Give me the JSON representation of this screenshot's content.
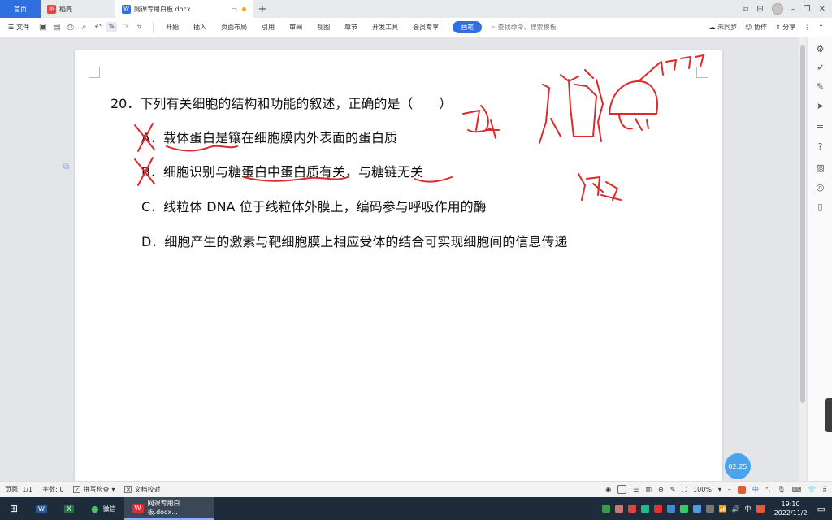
{
  "titlebar": {
    "home_tab": "首页",
    "tab_dao": "稻壳",
    "tab_doc": "网课专用白板.docx",
    "new_tab": "+"
  },
  "menubar": {
    "file": "文件",
    "items": [
      "开始",
      "插入",
      "页面布局",
      "引用",
      "审阅",
      "视图",
      "章节",
      "开发工具",
      "会员专享"
    ],
    "pen": "画笔",
    "search_placeholder": "查找命令、搜索模板",
    "sync": "未同步",
    "collab": "协作",
    "share": "分享"
  },
  "document": {
    "question": "20．下列有关细胞的结构和功能的叙述，正确的是（　　）",
    "options": [
      "A．载体蛋白是镶在细胞膜内外表面的蛋白质",
      "B．细胞识别与糖蛋白中蛋白质有关，与糖链无关",
      "C．线粒体 DNA 位于线粒体外膜上，编码参与呼吸作用的酶",
      "D．细胞产生的激素与靶细胞膜上相应受体的结合可实现细胞间的信息传递"
    ]
  },
  "timer": "02:25",
  "statusbar": {
    "page": "页面: 1/1",
    "words": "字数: 0",
    "spell": "拼写检查",
    "proof": "文档校对",
    "zoom": "100%"
  },
  "taskbar": {
    "wechat": "微信",
    "wps_doc": "网课专用白板.docx...",
    "ime": "中",
    "time": "19:10",
    "date": "2022/11/2"
  },
  "colors": {
    "accent": "#2f6fde",
    "ink": "#e0282a",
    "taskbar": "#1e2b3a"
  }
}
